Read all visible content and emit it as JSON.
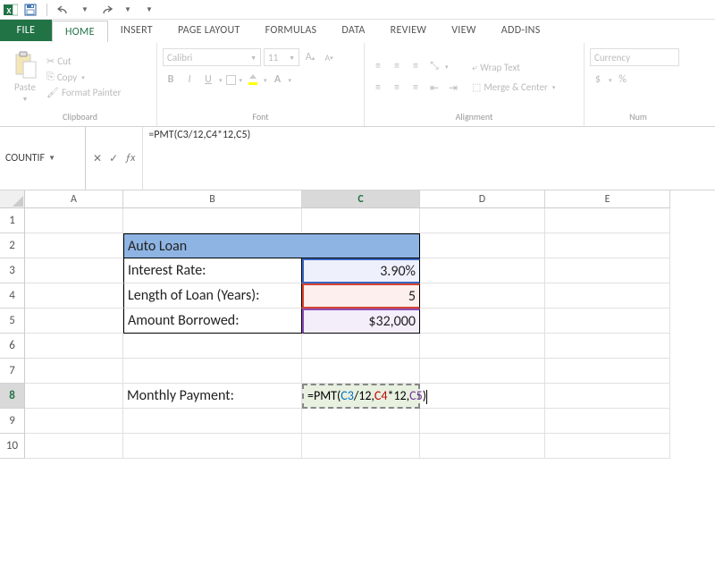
{
  "qat": {
    "save_tip": "Save",
    "undo": "↶",
    "redo": "↷",
    "more": "▾"
  },
  "tabs": {
    "file": "FILE",
    "home": "HOME",
    "insert": "INSERT",
    "page": "PAGE LAYOUT",
    "formulas": "FORMULAS",
    "data": "DATA",
    "review": "REVIEW",
    "view": "VIEW",
    "addins": "ADD-INS"
  },
  "ribbon": {
    "clipboard": {
      "label": "Clipboard",
      "paste": "Paste",
      "cut": "Cut",
      "copy": "Copy",
      "format": "Format Painter"
    },
    "font": {
      "label": "Font",
      "name": "Calibri",
      "size": "11",
      "bold": "B",
      "italic": "I",
      "underline": "U"
    },
    "alignment": {
      "label": "Alignment",
      "wrap": "Wrap Text",
      "merge": "Merge & Center"
    },
    "number": {
      "label": "Num",
      "format": "Currency",
      "dollar": "$",
      "percent": "%"
    }
  },
  "formula_bar": {
    "name_box": "COUNTIF",
    "cancel": "✕",
    "enter": "✓",
    "fx": "ƒx",
    "formula": "=PMT(C3/12,C4*12,C5)"
  },
  "grid": {
    "cols": [
      "A",
      "B",
      "C",
      "D",
      "E"
    ],
    "rows": [
      "1",
      "2",
      "3",
      "4",
      "5",
      "6",
      "7",
      "8",
      "9",
      "10"
    ],
    "active_col": "C",
    "active_row": "8",
    "b2": "Auto Loan",
    "b3": "Interest Rate:",
    "c3": "3.90%",
    "b4": "Length of Loan (Years):",
    "c4": "5",
    "b5": "Amount Borrowed:",
    "c5": "$32,000",
    "b8": "Monthly Payment:",
    "c8_prefix": "=PMT(",
    "c8_ref1": "C3",
    "c8_mid1": "/12,",
    "c8_ref2": "C4",
    "c8_mid2": "*12,",
    "c8_ref3": "C5",
    "c8_suffix": ")"
  }
}
